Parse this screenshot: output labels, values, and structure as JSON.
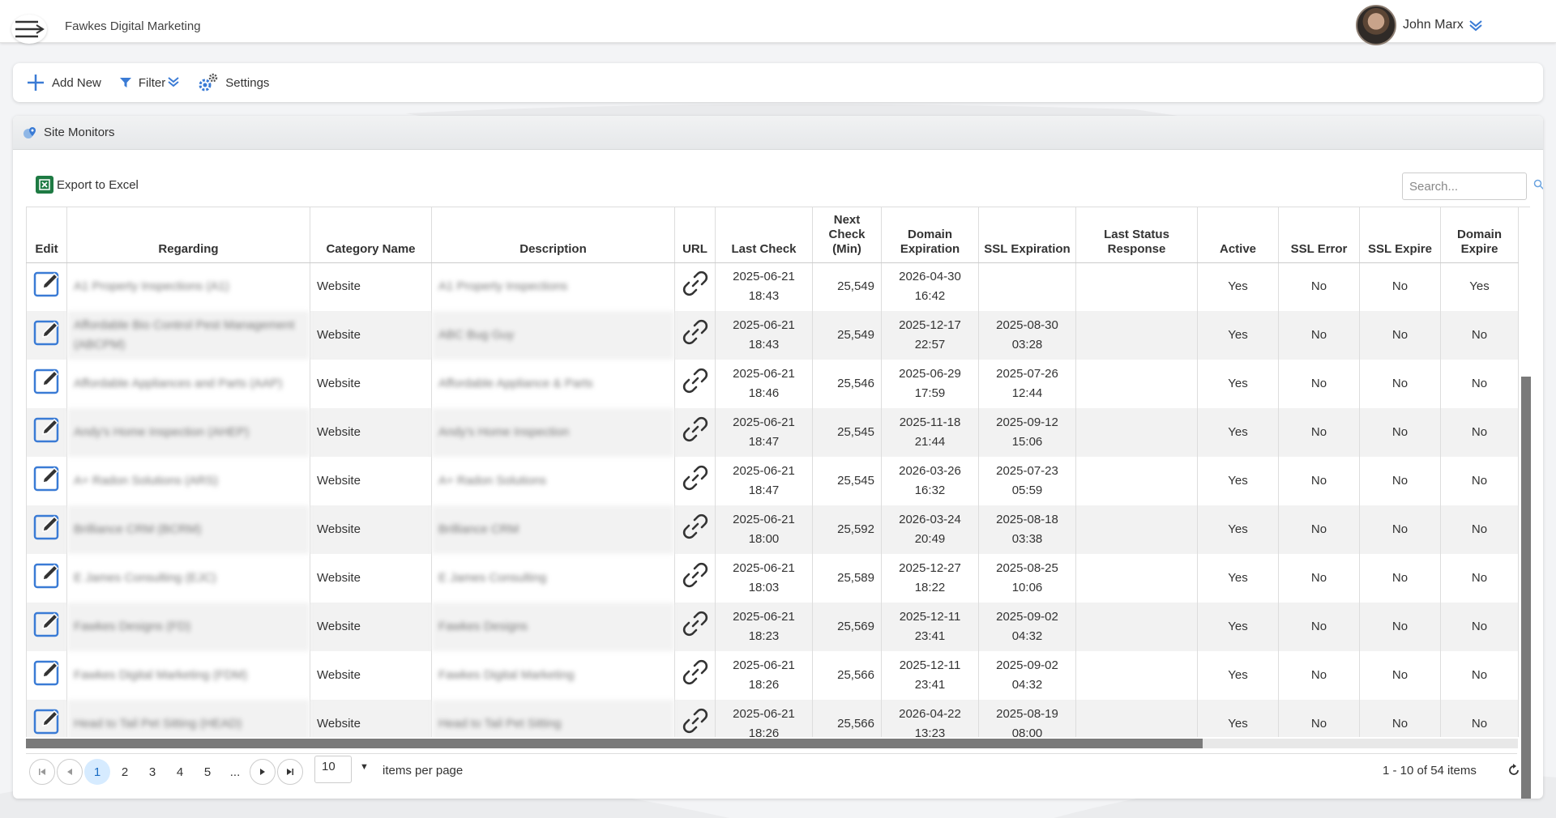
{
  "app": {
    "company": "Fawkes Digital Marketing",
    "user_name": "John Marx"
  },
  "toolbar": {
    "add_new": "Add New",
    "filter": "Filter",
    "settings": "Settings"
  },
  "panel": {
    "title": "Site Monitors",
    "export": "Export to Excel",
    "search_placeholder": "Search..."
  },
  "columns": [
    "Edit",
    "Regarding",
    "Category Name",
    "Description",
    "URL",
    "Last Check",
    "Next Check (Min)",
    "Domain Expiration",
    "SSL Expiration",
    "Last Status Response",
    "Active",
    "SSL Error",
    "SSL Expire",
    "Domain Expire"
  ],
  "rows": [
    {
      "regarding": "A1 Property Inspections (A1)",
      "category": "Website",
      "description": "A1 Property Inspections",
      "last_check_date": "2025-06-21",
      "last_check_time": "18:43",
      "next_check": "25,549",
      "domain_exp_date": "2026-04-30",
      "domain_exp_time": "16:42",
      "ssl_exp_date": "",
      "ssl_exp_time": "",
      "status": "",
      "active": "Yes",
      "ssl_error": "No",
      "ssl_expire": "No",
      "domain_expire": "Yes"
    },
    {
      "regarding": "Affordable Bio Control Pest Management (ABCPM)",
      "category": "Website",
      "description": "ABC Bug Guy",
      "last_check_date": "2025-06-21",
      "last_check_time": "18:43",
      "next_check": "25,549",
      "domain_exp_date": "2025-12-17",
      "domain_exp_time": "22:57",
      "ssl_exp_date": "2025-08-30",
      "ssl_exp_time": "03:28",
      "status": "",
      "active": "Yes",
      "ssl_error": "No",
      "ssl_expire": "No",
      "domain_expire": "No"
    },
    {
      "regarding": "Affordable Appliances and Parts (AAP)",
      "category": "Website",
      "description": "Affordable Appliance & Parts",
      "last_check_date": "2025-06-21",
      "last_check_time": "18:46",
      "next_check": "25,546",
      "domain_exp_date": "2025-06-29",
      "domain_exp_time": "17:59",
      "ssl_exp_date": "2025-07-26",
      "ssl_exp_time": "12:44",
      "status": "",
      "active": "Yes",
      "ssl_error": "No",
      "ssl_expire": "No",
      "domain_expire": "No"
    },
    {
      "regarding": "Andy's Home Inspection (AHEP)",
      "category": "Website",
      "description": "Andy's Home Inspection",
      "last_check_date": "2025-06-21",
      "last_check_time": "18:47",
      "next_check": "25,545",
      "domain_exp_date": "2025-11-18",
      "domain_exp_time": "21:44",
      "ssl_exp_date": "2025-09-12",
      "ssl_exp_time": "15:06",
      "status": "",
      "active": "Yes",
      "ssl_error": "No",
      "ssl_expire": "No",
      "domain_expire": "No"
    },
    {
      "regarding": "A+ Radon Solutions (ARS)",
      "category": "Website",
      "description": "A+ Radon Solutions",
      "last_check_date": "2025-06-21",
      "last_check_time": "18:47",
      "next_check": "25,545",
      "domain_exp_date": "2026-03-26",
      "domain_exp_time": "16:32",
      "ssl_exp_date": "2025-07-23",
      "ssl_exp_time": "05:59",
      "status": "",
      "active": "Yes",
      "ssl_error": "No",
      "ssl_expire": "No",
      "domain_expire": "No"
    },
    {
      "regarding": "Brilliance CRM (BCRM)",
      "category": "Website",
      "description": "Brilliance CRM",
      "last_check_date": "2025-06-21",
      "last_check_time": "18:00",
      "next_check": "25,592",
      "domain_exp_date": "2026-03-24",
      "domain_exp_time": "20:49",
      "ssl_exp_date": "2025-08-18",
      "ssl_exp_time": "03:38",
      "status": "",
      "active": "Yes",
      "ssl_error": "No",
      "ssl_expire": "No",
      "domain_expire": "No"
    },
    {
      "regarding": "E James Consulting (EJC)",
      "category": "Website",
      "description": "E James Consulting",
      "last_check_date": "2025-06-21",
      "last_check_time": "18:03",
      "next_check": "25,589",
      "domain_exp_date": "2025-12-27",
      "domain_exp_time": "18:22",
      "ssl_exp_date": "2025-08-25",
      "ssl_exp_time": "10:06",
      "status": "",
      "active": "Yes",
      "ssl_error": "No",
      "ssl_expire": "No",
      "domain_expire": "No"
    },
    {
      "regarding": "Fawkes Designs (FD)",
      "category": "Website",
      "description": "Fawkes Designs",
      "last_check_date": "2025-06-21",
      "last_check_time": "18:23",
      "next_check": "25,569",
      "domain_exp_date": "2025-12-11",
      "domain_exp_time": "23:41",
      "ssl_exp_date": "2025-09-02",
      "ssl_exp_time": "04:32",
      "status": "",
      "active": "Yes",
      "ssl_error": "No",
      "ssl_expire": "No",
      "domain_expire": "No"
    },
    {
      "regarding": "Fawkes Digital Marketing (FDM)",
      "category": "Website",
      "description": "Fawkes Digital Marketing",
      "last_check_date": "2025-06-21",
      "last_check_time": "18:26",
      "next_check": "25,566",
      "domain_exp_date": "2025-12-11",
      "domain_exp_time": "23:41",
      "ssl_exp_date": "2025-09-02",
      "ssl_exp_time": "04:32",
      "status": "",
      "active": "Yes",
      "ssl_error": "No",
      "ssl_expire": "No",
      "domain_expire": "No"
    },
    {
      "regarding": "Head to Tail Pet Sitting (HEAD)",
      "category": "Website",
      "description": "Head to Tail Pet Sitting",
      "last_check_date": "2025-06-21",
      "last_check_time": "18:26",
      "next_check": "25,566",
      "domain_exp_date": "2026-04-22",
      "domain_exp_time": "13:23",
      "ssl_exp_date": "2025-08-19",
      "ssl_exp_time": "08:00",
      "status": "",
      "active": "Yes",
      "ssl_error": "No",
      "ssl_expire": "No",
      "domain_expire": "No"
    }
  ],
  "pager": {
    "pages": [
      "1",
      "2",
      "3",
      "4",
      "5",
      "..."
    ],
    "per_page": "10",
    "per_page_label": "items per page",
    "info": "1 - 10 of 54 items"
  },
  "colors": {
    "accent": "#3a7bd5",
    "active_page_bg": "#d6ebff",
    "excel_green": "#1e7a43",
    "scrollbar": "#7a7a7a"
  }
}
